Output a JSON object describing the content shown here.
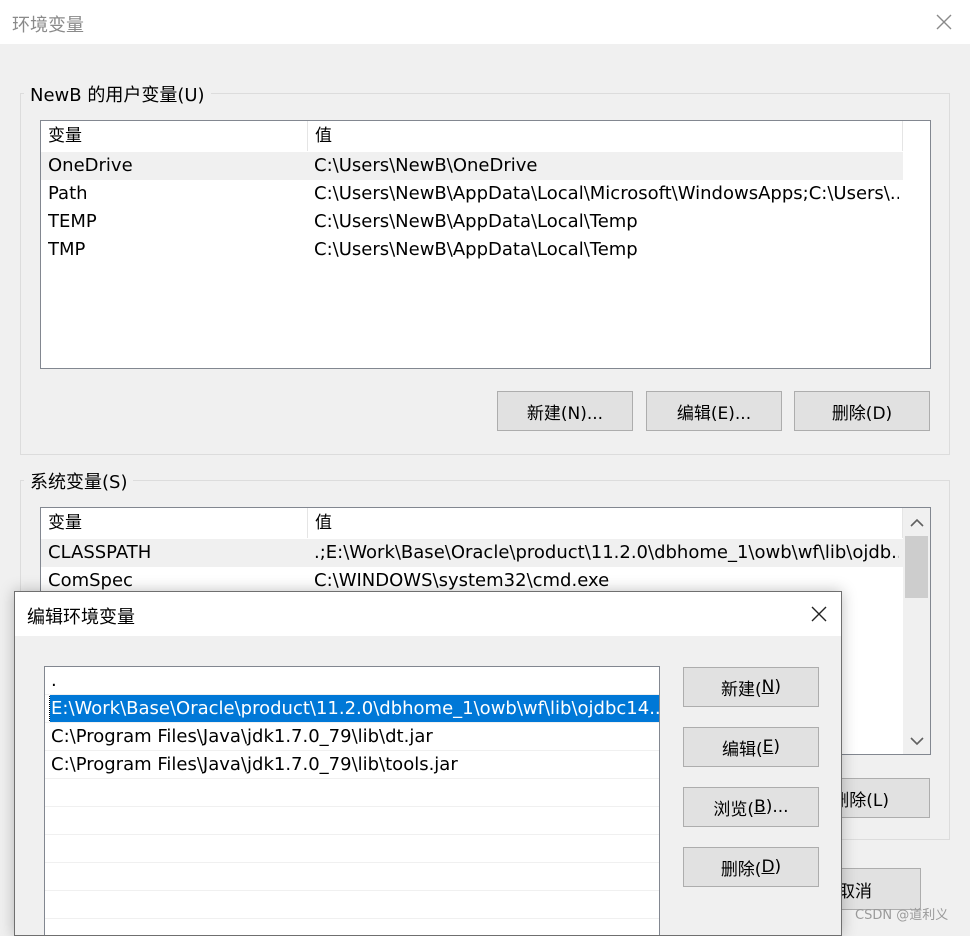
{
  "main_window": {
    "title": "环境变量",
    "close_icon": "close-icon"
  },
  "user_vars": {
    "group_label": "NewB 的用户变量(U)",
    "columns": [
      "变量",
      "值"
    ],
    "rows": [
      {
        "name": "OneDrive",
        "value": "C:\\Users\\NewB\\OneDrive"
      },
      {
        "name": "Path",
        "value": "C:\\Users\\NewB\\AppData\\Local\\Microsoft\\WindowsApps;C:\\Users\\..."
      },
      {
        "name": "TEMP",
        "value": "C:\\Users\\NewB\\AppData\\Local\\Temp"
      },
      {
        "name": "TMP",
        "value": "C:\\Users\\NewB\\AppData\\Local\\Temp"
      }
    ],
    "selected_index": 0,
    "buttons": {
      "new": "新建(N)...",
      "edit": "编辑(E)...",
      "delete": "删除(D)"
    }
  },
  "system_vars": {
    "group_label": "系统变量(S)",
    "columns": [
      "变量",
      "值"
    ],
    "rows": [
      {
        "name": "CLASSPATH",
        "value": ".;E:\\Work\\Base\\Oracle\\product\\11.2.0\\dbhome_1\\owb\\wf\\lib\\ojdb..."
      },
      {
        "name": "ComSpec",
        "value": "C:\\WINDOWS\\system32\\cmd.exe"
      }
    ],
    "selected_index": 0,
    "delete_button_partial": "删除(L)",
    "cancel_button_partial": "取消"
  },
  "edit_dialog": {
    "title": "编辑环境变量",
    "entries": [
      ".",
      "E:\\Work\\Base\\Oracle\\product\\11.2.0\\dbhome_1\\owb\\wf\\lib\\ojdbc14....",
      "C:\\Program Files\\Java\\jdk1.7.0_79\\lib\\dt.jar",
      "C:\\Program Files\\Java\\jdk1.7.0_79\\lib\\tools.jar"
    ],
    "selected_index": 1,
    "buttons": {
      "new": {
        "text": "新建(",
        "key": "N",
        "tail": ")"
      },
      "edit": {
        "text": "编辑(",
        "key": "E",
        "tail": ")"
      },
      "browse": {
        "text": "浏览(",
        "key": "B",
        "tail": ")..."
      },
      "delete": {
        "text": "删除(",
        "key": "D",
        "tail": ")"
      }
    }
  },
  "watermark": "CSDN @道利义",
  "colors": {
    "selection": "#0078d7",
    "window_bg": "#f0f0f0",
    "border": "#828790"
  }
}
